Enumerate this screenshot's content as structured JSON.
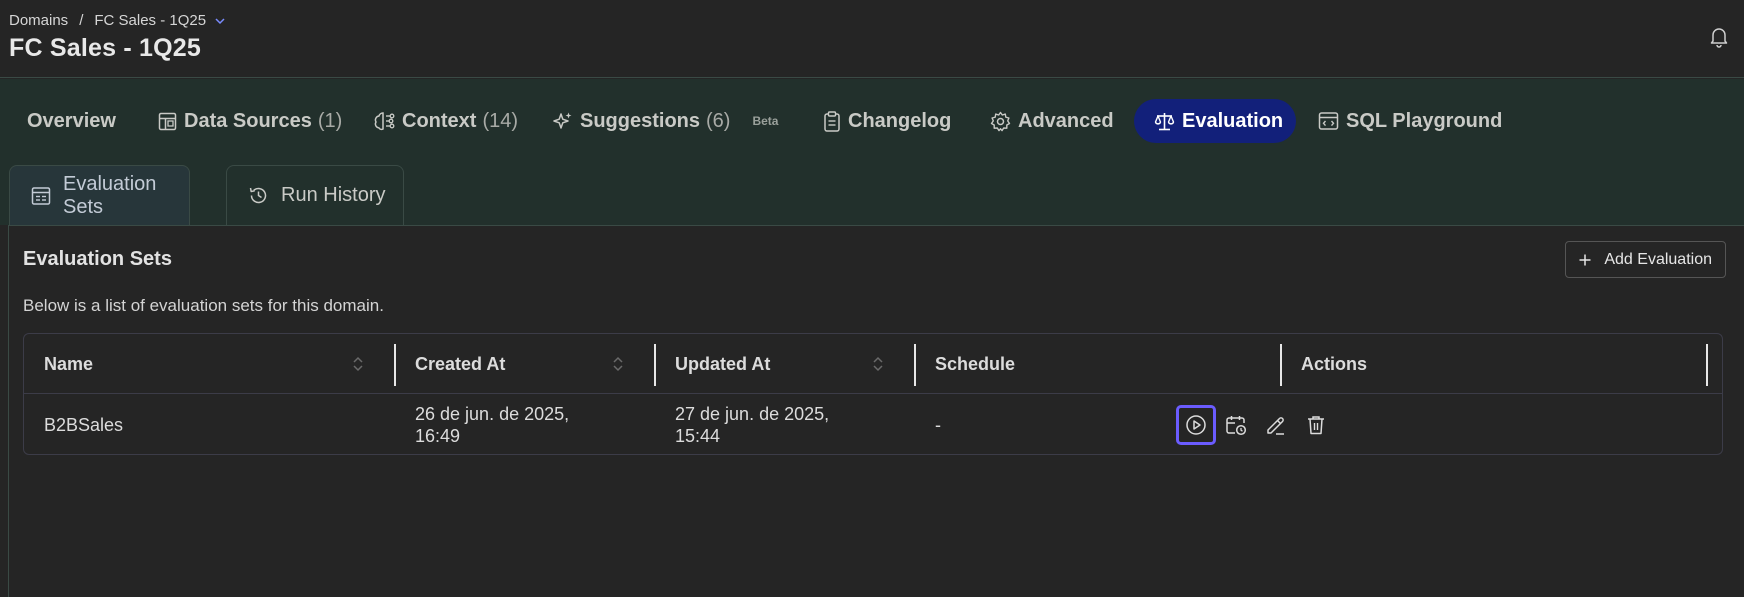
{
  "header": {
    "breadcrumb": [
      "Domains",
      "FC Sales - 1Q25"
    ],
    "separator": "/",
    "title": "FC Sales - 1Q25"
  },
  "nav": {
    "items": [
      {
        "label": "Overview",
        "count": "",
        "icon": "none"
      },
      {
        "label": "Data Sources",
        "count": "(1)",
        "icon": "layout-icon"
      },
      {
        "label": "Context",
        "count": "(14)",
        "icon": "brain-icon"
      },
      {
        "label": "Suggestions",
        "count": "(6)",
        "icon": "sparkles-icon",
        "badge": "Beta"
      },
      {
        "label": "Changelog",
        "count": "",
        "icon": "clipboard-icon"
      },
      {
        "label": "Advanced",
        "count": "",
        "icon": "gear-icon"
      },
      {
        "label": "Evaluation",
        "count": "",
        "icon": "scale-icon",
        "active": true
      },
      {
        "label": "SQL Playground",
        "count": "",
        "icon": "code-window-icon"
      }
    ]
  },
  "subtabs": [
    {
      "label": "Evaluation Sets",
      "icon": "table-icon",
      "active": true
    },
    {
      "label": "Run History",
      "icon": "history-icon"
    }
  ],
  "section": {
    "title": "Evaluation Sets",
    "description": "Below is a list of evaluation sets for this domain.",
    "add_button": "Add Evaluation"
  },
  "table": {
    "columns": [
      "Name",
      "Created At",
      "Updated At",
      "Schedule",
      "Actions"
    ],
    "rows": [
      {
        "name": "B2BSales",
        "created_at": [
          "26 de jun. de 2025,",
          "16:49"
        ],
        "updated_at": [
          "27 de jun. de 2025,",
          "15:44"
        ],
        "schedule": "-",
        "actions": [
          "play-icon",
          "calendar-clock-icon",
          "pencil-icon",
          "trash-icon"
        ]
      }
    ]
  },
  "colors": {
    "background": "#252525",
    "nav_background": "#22302c",
    "active_tab": "#12207a",
    "focus_ring": "#6b5cff"
  }
}
